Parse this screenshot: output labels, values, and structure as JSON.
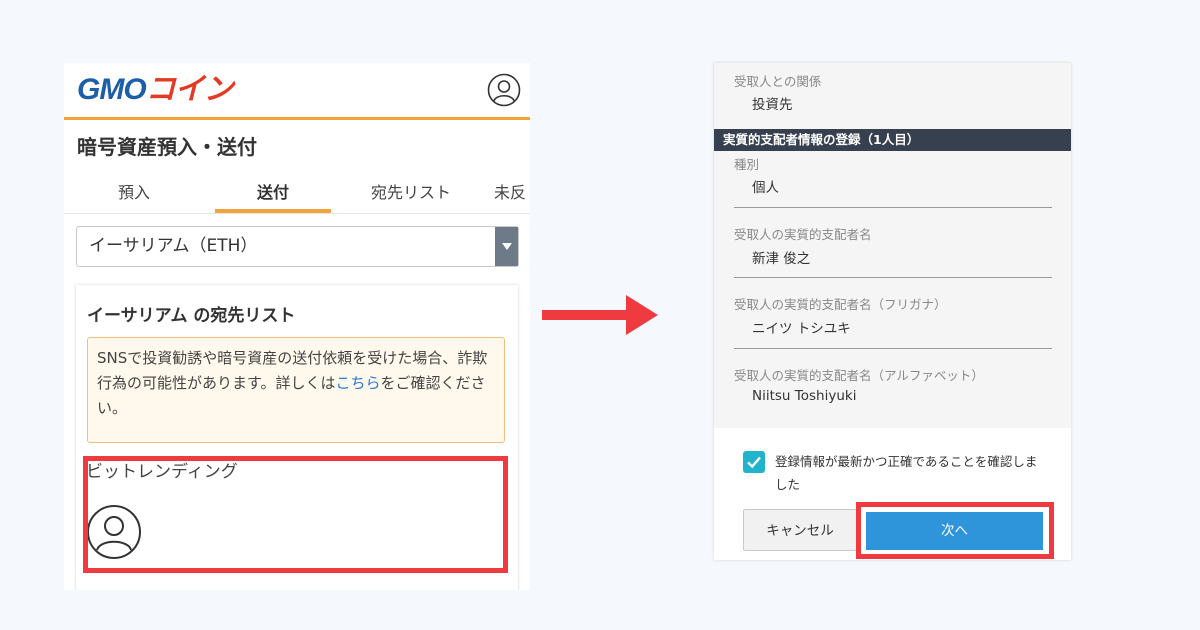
{
  "left": {
    "logo": {
      "gmo": "GMO",
      "coin": "コイン"
    },
    "page_title": "暗号資産預入・送付",
    "tabs": [
      {
        "label": "預入",
        "active": false
      },
      {
        "label": "送付",
        "active": true
      },
      {
        "label": "宛先リスト",
        "active": false
      },
      {
        "label": "未反",
        "active": false
      }
    ],
    "currency_select": {
      "value": "イーサリアム（ETH）"
    },
    "card": {
      "title": "イーサリアム の宛先リスト",
      "notice_before": "SNSで投資勧誘や暗号資産の送付依頼を受けた場合、詐欺行為の可能性があります。詳しくは",
      "notice_link": "こちら",
      "notice_after": "をご確認ください。",
      "entry_name": "ビットレンディング"
    }
  },
  "right": {
    "relation": {
      "label": "受取人との関係",
      "value": "投資先"
    },
    "section_header": "実質的支配者情報の登録（1人目）",
    "fields": [
      {
        "label": "種別",
        "value": "個人"
      },
      {
        "label": "受取人の実質的支配者名",
        "value": "新津 俊之"
      },
      {
        "label": "受取人の実質的支配者名（フリガナ）",
        "value": "ニイツ トシユキ"
      },
      {
        "label": "受取人の実質的支配者名（アルファベット）",
        "value": "Niitsu Toshiyuki"
      }
    ],
    "confirm_text": "登録情報が最新かつ正確であることを確認しました",
    "confirm_checked": true,
    "cancel_label": "キャンセル",
    "next_label": "次へ"
  },
  "colors": {
    "accent_orange": "#f2a33a",
    "highlight_red": "#ef3a3f",
    "next_blue": "#2f95db",
    "checkbox_teal": "#21b3cc",
    "section_dark": "#36404e"
  },
  "icons": [
    "user-circle-icon",
    "avatar-icon",
    "dropdown-arrow-icon",
    "right-arrow-icon",
    "checkmark-icon"
  ]
}
